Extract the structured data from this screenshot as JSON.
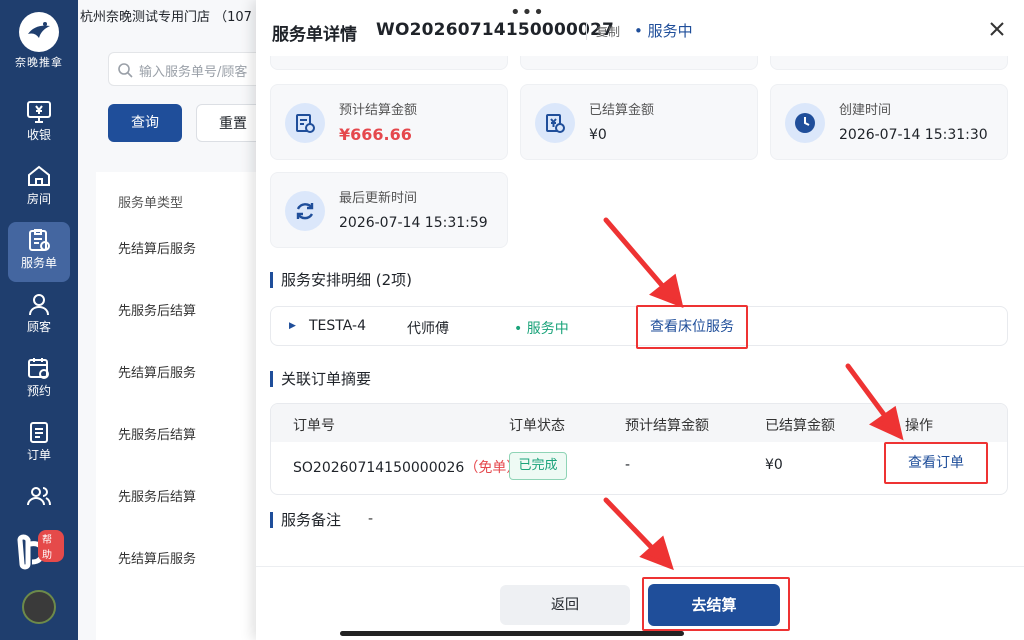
{
  "sidebar": {
    "logo_text": "奈晚推拿",
    "items": [
      {
        "label": "收银",
        "icon": "monitor-yen-icon"
      },
      {
        "label": "房间",
        "icon": "home-icon"
      },
      {
        "label": "服务单",
        "icon": "clipboard-icon"
      },
      {
        "label": "顾客",
        "icon": "user-icon"
      },
      {
        "label": "预约",
        "icon": "calendar-clock-icon"
      },
      {
        "label": "订单",
        "icon": "list-icon"
      },
      {
        "label": "",
        "icon": "users-icon"
      }
    ],
    "help_badge": "帮助"
  },
  "background": {
    "store_name": "杭州奈晚测试专用门店 （107",
    "search_placeholder": "输入服务单号/顾客",
    "query_button": "查询",
    "reset_button": "重置",
    "table_header": "服务单类型",
    "rows": [
      "先结算后服务",
      "先服务后结算",
      "先结算后服务",
      "先服务后结算",
      "先服务后结算",
      "先结算后服务"
    ]
  },
  "drawer": {
    "title": "服务单详情",
    "order_no": "WO20260714150000027",
    "copy_label": "复制",
    "status": "服务中",
    "cards": [
      {
        "label": "预计结算金额",
        "value": "¥666.66",
        "icon": "invoice-clock-icon"
      },
      {
        "label": "已结算金额",
        "value": "¥0",
        "icon": "yen-check-icon"
      },
      {
        "label": "创建时间",
        "value": "2026-07-14 15:31:30",
        "icon": "clock-icon"
      },
      {
        "label": "最后更新时间",
        "value": "2026-07-14 15:31:59",
        "icon": "refresh-icon"
      }
    ],
    "arrangement": {
      "title": "服务安排明细 (2项)",
      "room": "TESTA-4",
      "technician": "代师傅",
      "status": "服务中",
      "link": "查看床位服务"
    },
    "orders": {
      "title": "关联订单摘要",
      "headers": [
        "订单号",
        "订单状态",
        "预计结算金额",
        "已结算金额",
        "操作"
      ],
      "row": {
        "order_no": "SO20260714150000026",
        "free_tag": "（免单）",
        "status": "已完成",
        "estimated": "-",
        "settled": "¥0",
        "action": "查看订单"
      }
    },
    "remark": {
      "title": "服务备注",
      "value": "-"
    },
    "footer": {
      "back": "返回",
      "settle": "去结算"
    }
  },
  "colors": {
    "primary": "#1f4e9a",
    "sidebar": "#1f3e6e",
    "danger": "#e5484d",
    "success": "#1aa37a",
    "highlight": "#e33333"
  }
}
